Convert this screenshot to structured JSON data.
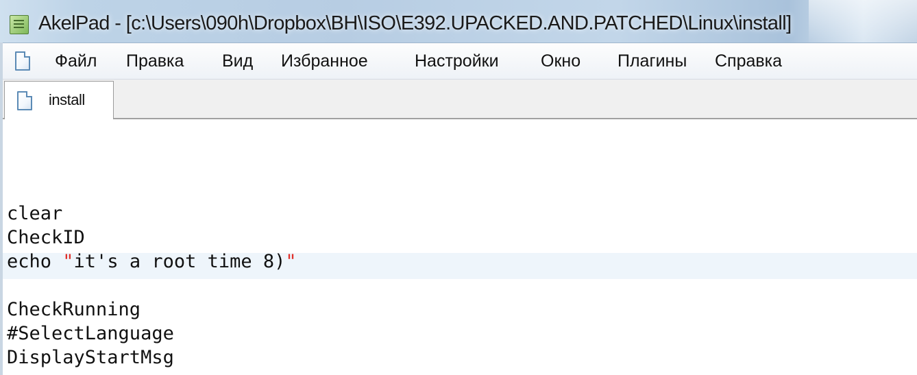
{
  "window": {
    "title": "AkelPad - [c:\\Users\\090h\\Dropbox\\BH\\ISO\\E392.UPACKED.AND.PATCHED\\Linux\\install]"
  },
  "menu": {
    "items": [
      {
        "id": "file",
        "label": "Файл"
      },
      {
        "id": "edit",
        "label": "Правка"
      },
      {
        "id": "view",
        "label": "Вид"
      },
      {
        "id": "favorites",
        "label": "Избранное"
      },
      {
        "id": "settings",
        "label": "Настройки"
      },
      {
        "id": "window",
        "label": "Окно"
      },
      {
        "id": "plugins",
        "label": "Плагины"
      },
      {
        "id": "help",
        "label": "Справка"
      }
    ]
  },
  "tabs": [
    {
      "label": "install",
      "active": true
    }
  ],
  "editor": {
    "line1": "clear",
    "line2": "CheckID",
    "line3_prefix": "echo ",
    "line3_quote_open": "\"",
    "line3_string": "it's a root time 8)",
    "line3_quote_close": "\"",
    "line4": "CheckRunning",
    "line5": "#SelectLanguage",
    "line6": "DisplayStartMsg"
  },
  "colors": {
    "string_quote": "#e0302a",
    "current_line_highlight": "#eef5fb",
    "titlebar": "#bdd3e7",
    "doc_icon_border": "#5b8ab5"
  },
  "icons": {
    "app": "akelpad-app-icon",
    "menu_doc": "document-icon",
    "tab_doc": "document-icon"
  }
}
